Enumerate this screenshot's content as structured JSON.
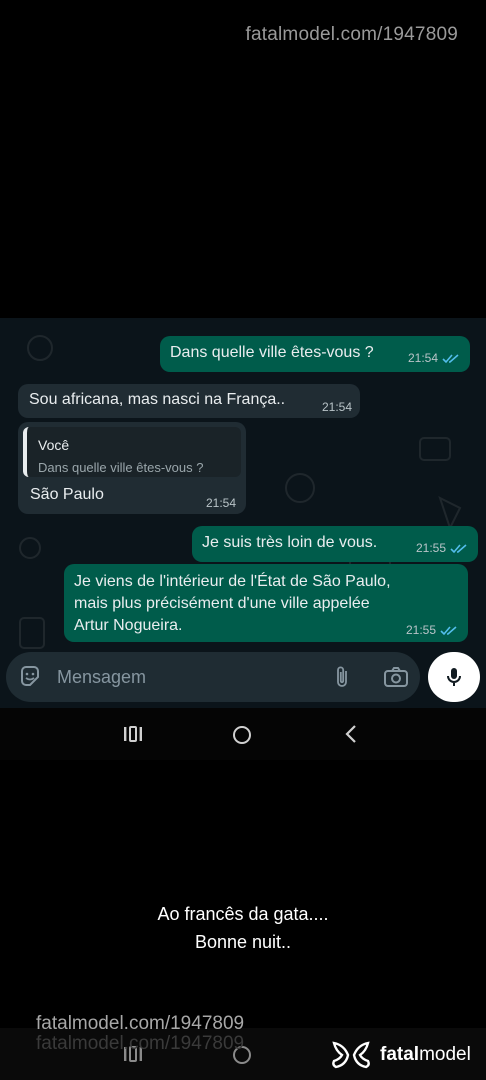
{
  "watermark": {
    "top": "fatalmodel.com/1947809",
    "bottom": "fatalmodel.com/1947809",
    "bottom_ghost": "fatalmodel.com/1947809"
  },
  "messages": [
    {
      "text": "Dans quelle ville êtes-vous ?",
      "time": "21:54",
      "direction": "out"
    },
    {
      "text": "Sou africana, mas nasci na França..",
      "time": "21:54",
      "direction": "in"
    },
    {
      "quote_author": "Você",
      "quote_text": "Dans quelle ville êtes-vous ?",
      "text": "São Paulo",
      "time": "21:54",
      "direction": "in"
    },
    {
      "text": "Je suis très loin de vous.",
      "time": "21:55",
      "direction": "out"
    },
    {
      "lines": [
        "Je viens de l'intérieur de l'État de São Paulo,",
        "mais plus précisément d'une ville appelée",
        "Artur Nogueira."
      ],
      "time": "21:55",
      "direction": "out"
    }
  ],
  "input": {
    "placeholder": "Mensagem"
  },
  "caption": {
    "line1": "Ao francês da gata....",
    "line2": "Bonne nuit.."
  },
  "brand": {
    "prefix": "fatal",
    "suffix": "model"
  },
  "colors": {
    "outgoing": "#005c4b",
    "incoming": "#202c33",
    "read_tick": "#53bdeb",
    "background": "#0b141a"
  }
}
